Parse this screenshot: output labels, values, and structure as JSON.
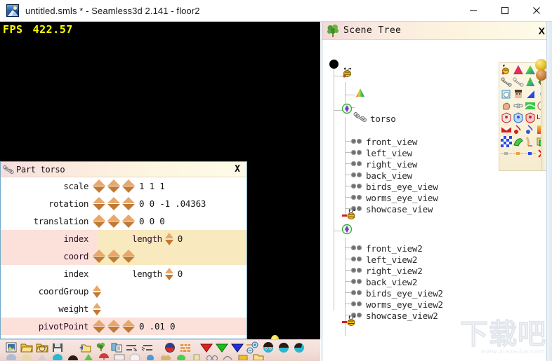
{
  "window": {
    "title": "untitled.smls * - Seamless3d 2.141 - floor2",
    "app_icon": "seamless3d-app-icon",
    "controls": {
      "minimize": "minimize-icon",
      "maximize": "maximize-icon",
      "close": "close-icon"
    }
  },
  "viewport": {
    "fps_label": "FPS",
    "fps_value": "422.57",
    "background": "#000000",
    "object": "torso-mesh-preview"
  },
  "part_dialog": {
    "title": "Part torso",
    "title_icon": "bone-icon",
    "close_label": "X",
    "rows": [
      {
        "label": "scale",
        "spinners": 3,
        "value": "1 1 1",
        "band": "white"
      },
      {
        "label": "rotation",
        "spinners": 3,
        "value": "0 0 -1 .04363",
        "band": "white"
      },
      {
        "label": "translation",
        "spinners": 3,
        "value": "0 0 0",
        "band": "white"
      },
      {
        "label": "index",
        "length_label": "length",
        "length_value": "0",
        "band": "pink",
        "right_band": "yellow"
      },
      {
        "label": "coord",
        "spinners": 3,
        "value": "",
        "band": "pink",
        "right_band": "yellow"
      },
      {
        "label": "index",
        "length_label": "length",
        "length_value": "0",
        "band": "white",
        "right_band": "white",
        "plain": true
      },
      {
        "label": "coordGroup",
        "spinners": 1,
        "value": "",
        "band": "white",
        "plain": true
      },
      {
        "label": "weight",
        "spinners": 1,
        "value": "",
        "band": "white",
        "plain": true
      },
      {
        "label": "pivotPoint",
        "spinners": 3,
        "value": "0 .01 0",
        "band": "pink"
      }
    ]
  },
  "bottom_toolbar": {
    "icons": [
      "new-file-icon",
      "open-folder-icon",
      "open-folder-alt-icon",
      "save-icon",
      "import-mesh-icon",
      "tree-icon",
      "copy-icon",
      "wireframe-icon",
      "wireframe-alt-icon",
      "sphere-icon",
      "brick-texture-icon",
      "arrow-down-red-icon",
      "arrow-down-green-icon",
      "arrow-down-blue-icon",
      "zoom-in-icon",
      "zoom-out-icon",
      "head-front-icon",
      "head-back-icon",
      "head-side-icon"
    ],
    "row2_icons": [
      "sphere-grey-icon",
      "sphere-tan-icon",
      "cone-icon",
      "sphere-cyan-icon",
      "hemisphere-icon",
      "cone-green-icon",
      "umbrella-icon",
      "card-icon",
      "sphere-white-icon",
      "drop-icon",
      "peanut-icon",
      "ball-green-icon",
      "cylinder-icon",
      "glasses-icon",
      "spiral-icon",
      "gold-icon",
      "folder-yellow-icon"
    ]
  },
  "scene_tree": {
    "title": "Scene Tree",
    "title_icon": "tree-icon",
    "close_label": "X",
    "root_node": "root-dot",
    "groups": [
      {
        "group_icon": "bee-icon",
        "node_icon": "cone-gradient-icon",
        "node_label": "torso",
        "node_label_icon": "bone-icon"
      },
      {
        "group_icon": "viewpoint-group-icon",
        "items": [
          {
            "label": "front_view",
            "icon": "viewpoint-icon"
          },
          {
            "label": "left_view",
            "icon": "viewpoint-icon"
          },
          {
            "label": "right_view",
            "icon": "viewpoint-icon"
          },
          {
            "label": "back_view",
            "icon": "viewpoint-icon"
          },
          {
            "label": "birds_eye_view",
            "icon": "viewpoint-icon"
          },
          {
            "label": "worms_eye_view",
            "icon": "viewpoint-icon"
          },
          {
            "label": "showcase_view",
            "icon": "viewpoint-icon"
          }
        ],
        "trailing_icon": "bee-icon"
      },
      {
        "group_icon": "viewpoint-group-icon",
        "items": [
          {
            "label": "front_view2",
            "icon": "viewpoint-icon"
          },
          {
            "label": "left_view2",
            "icon": "viewpoint-icon"
          },
          {
            "label": "right_view2",
            "icon": "viewpoint-icon"
          },
          {
            "label": "back_view2",
            "icon": "viewpoint-icon"
          },
          {
            "label": "birds_eye_view2",
            "icon": "viewpoint-icon"
          },
          {
            "label": "worms_eye_view2",
            "icon": "viewpoint-icon"
          },
          {
            "label": "showcase_view2",
            "icon": "viewpoint-icon"
          }
        ],
        "trailing_icon": "bee-icon"
      }
    ]
  },
  "palette": {
    "knob_icon": "pin-knob-icon",
    "cells": [
      "bee-icon",
      "triangle-red-icon",
      "triangle-rainbow-icon",
      "bar-green-icon",
      "bone-grey-icon",
      "bone-white-icon",
      "cone-rainbow-icon",
      "diamond-icon",
      "cube-outline-icon",
      "face-icon",
      "blue-triangle-icon",
      "droplet-icon",
      "hand-icon",
      "bone-joint-icon",
      "curve-green-icon",
      "circle-outline-icon",
      "shield-grey-icon",
      "shield-blue-icon",
      "shield-red-icon",
      "mirror-lr-icon",
      "envelope-icon",
      "pin-red-icon",
      "pin-blue-icon",
      "gradient-icon",
      "checker-icon",
      "hand-paint-icon",
      "leg-icon",
      "cube-green-icon",
      "dot-grey-icon",
      "dot-orange-icon",
      "dot-blue-icon",
      "delete-x-icon"
    ],
    "mirror_label": "L=R"
  },
  "watermark": {
    "text": "下载吧",
    "url": "www.xiazaiba.com"
  },
  "colors": {
    "accent_yellow": "#ffff00",
    "dialog_pink": "#fbe1da",
    "dialog_yellow": "#f8e9bf",
    "spinner_up": "#e8a86b",
    "spinner_down": "#c07a34",
    "title_gradient_start": "#f2d9d9",
    "title_gradient_end": "#fdfbe9"
  }
}
